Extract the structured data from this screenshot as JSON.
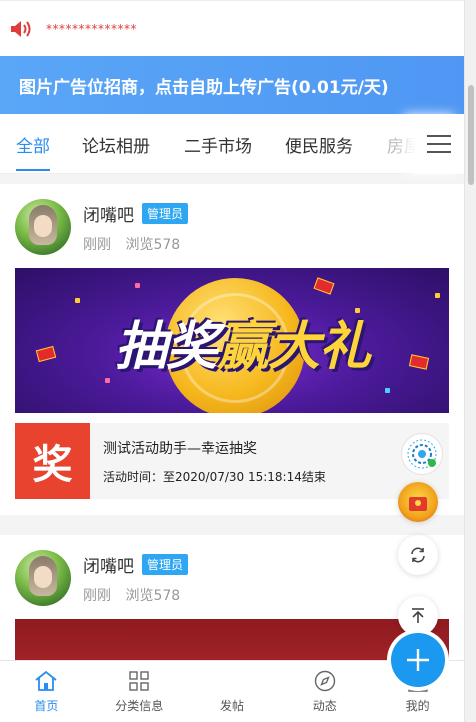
{
  "notice": {
    "text": "**************",
    "icon": "speaker-icon"
  },
  "banner": {
    "text": "图片广告位招商，点击自助上传广告(0.01元/天)"
  },
  "tabs": [
    {
      "label": "全部",
      "active": true
    },
    {
      "label": "论坛相册"
    },
    {
      "label": "二手市场"
    },
    {
      "label": "便民服务"
    },
    {
      "label": "房屋"
    }
  ],
  "posts": [
    {
      "author": "闭嘴吧",
      "badge": "管理员",
      "time": "刚刚",
      "views": "浏览578",
      "image_text": {
        "part1": "抽奖",
        "part2": "赢大礼"
      },
      "activity": {
        "icon_text": "奖",
        "title": "测试活动助手—幸运抽奖",
        "time": "活动时间：至2020/07/30 15:18:14结束"
      }
    },
    {
      "author": "闭嘴吧",
      "badge": "管理员",
      "time": "刚刚",
      "views": "浏览578"
    }
  ],
  "nav": {
    "home": "首页",
    "category": "分类信息",
    "post": "发帖",
    "feed": "动态",
    "mine": "我的"
  },
  "colors": {
    "accent": "#2a8cf0",
    "banner": "#4f97f3",
    "notice_text": "#e23b3b",
    "badge": "#2ea6f2"
  }
}
